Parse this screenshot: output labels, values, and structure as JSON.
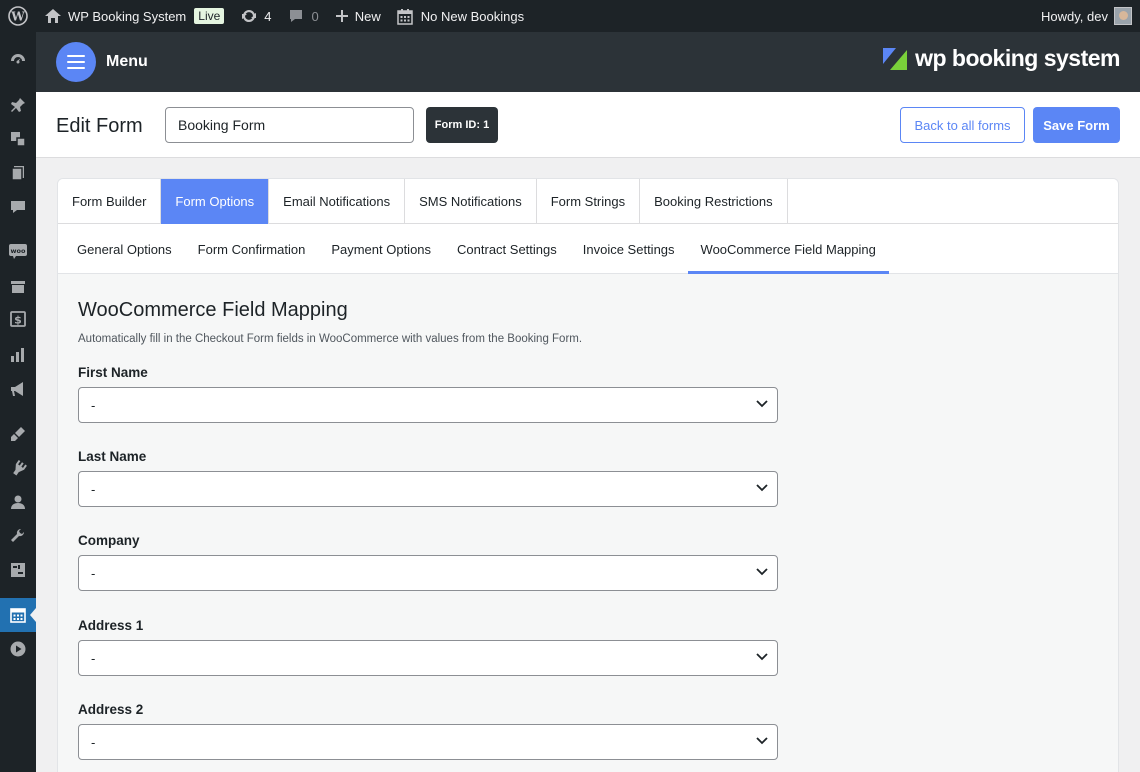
{
  "admin_bar": {
    "site_name": "WP Booking System",
    "live_badge": "Live",
    "updates_count": "4",
    "comments_count": "0",
    "new_label": "New",
    "bookings_label": "No New Bookings",
    "greeting": "Howdy, dev"
  },
  "sidebar": {
    "icons": [
      "dashboard-icon",
      "pin-icon",
      "media-icon",
      "pages-icon",
      "comments-icon",
      "woo-icon",
      "archive-icon",
      "money-icon",
      "chart-icon",
      "megaphone-icon",
      "appearance-icon",
      "plugins-icon",
      "users-icon",
      "tools-icon",
      "settings-icon",
      "calendar-icon",
      "play-icon"
    ],
    "active_icon": "calendar-icon"
  },
  "plugin_header": {
    "menu_label": "Menu",
    "brand_text": "wp booking system"
  },
  "edit_header": {
    "title": "Edit Form",
    "form_name": "Booking Form",
    "form_id": "Form ID: 1",
    "back_label": "Back to all forms",
    "save_label": "Save Form"
  },
  "tabs": [
    {
      "label": "Form Builder",
      "active": false
    },
    {
      "label": "Form Options",
      "active": true
    },
    {
      "label": "Email Notifications",
      "active": false
    },
    {
      "label": "SMS Notifications",
      "active": false
    },
    {
      "label": "Form Strings",
      "active": false
    },
    {
      "label": "Booking Restrictions",
      "active": false
    }
  ],
  "subtabs": [
    {
      "label": "General Options",
      "active": false
    },
    {
      "label": "Form Confirmation",
      "active": false
    },
    {
      "label": "Payment Options",
      "active": false
    },
    {
      "label": "Contract Settings",
      "active": false
    },
    {
      "label": "Invoice Settings",
      "active": false
    },
    {
      "label": "WooCommerce Field Mapping",
      "active": true
    }
  ],
  "section": {
    "title": "WooCommerce Field Mapping",
    "description": "Automatically fill in the Checkout Form fields in WooCommerce with values from the Booking Form."
  },
  "fields": [
    {
      "label": "First Name",
      "value": "-"
    },
    {
      "label": "Last Name",
      "value": "-"
    },
    {
      "label": "Company",
      "value": "-"
    },
    {
      "label": "Address 1",
      "value": "-"
    },
    {
      "label": "Address 2",
      "value": "-"
    }
  ],
  "colors": {
    "accent": "#5b86f5",
    "admin_bar": "#1d2327",
    "plugin_header": "#2c3338",
    "sidebar_active": "#2271b1",
    "brand_green": "#7ad03a"
  }
}
